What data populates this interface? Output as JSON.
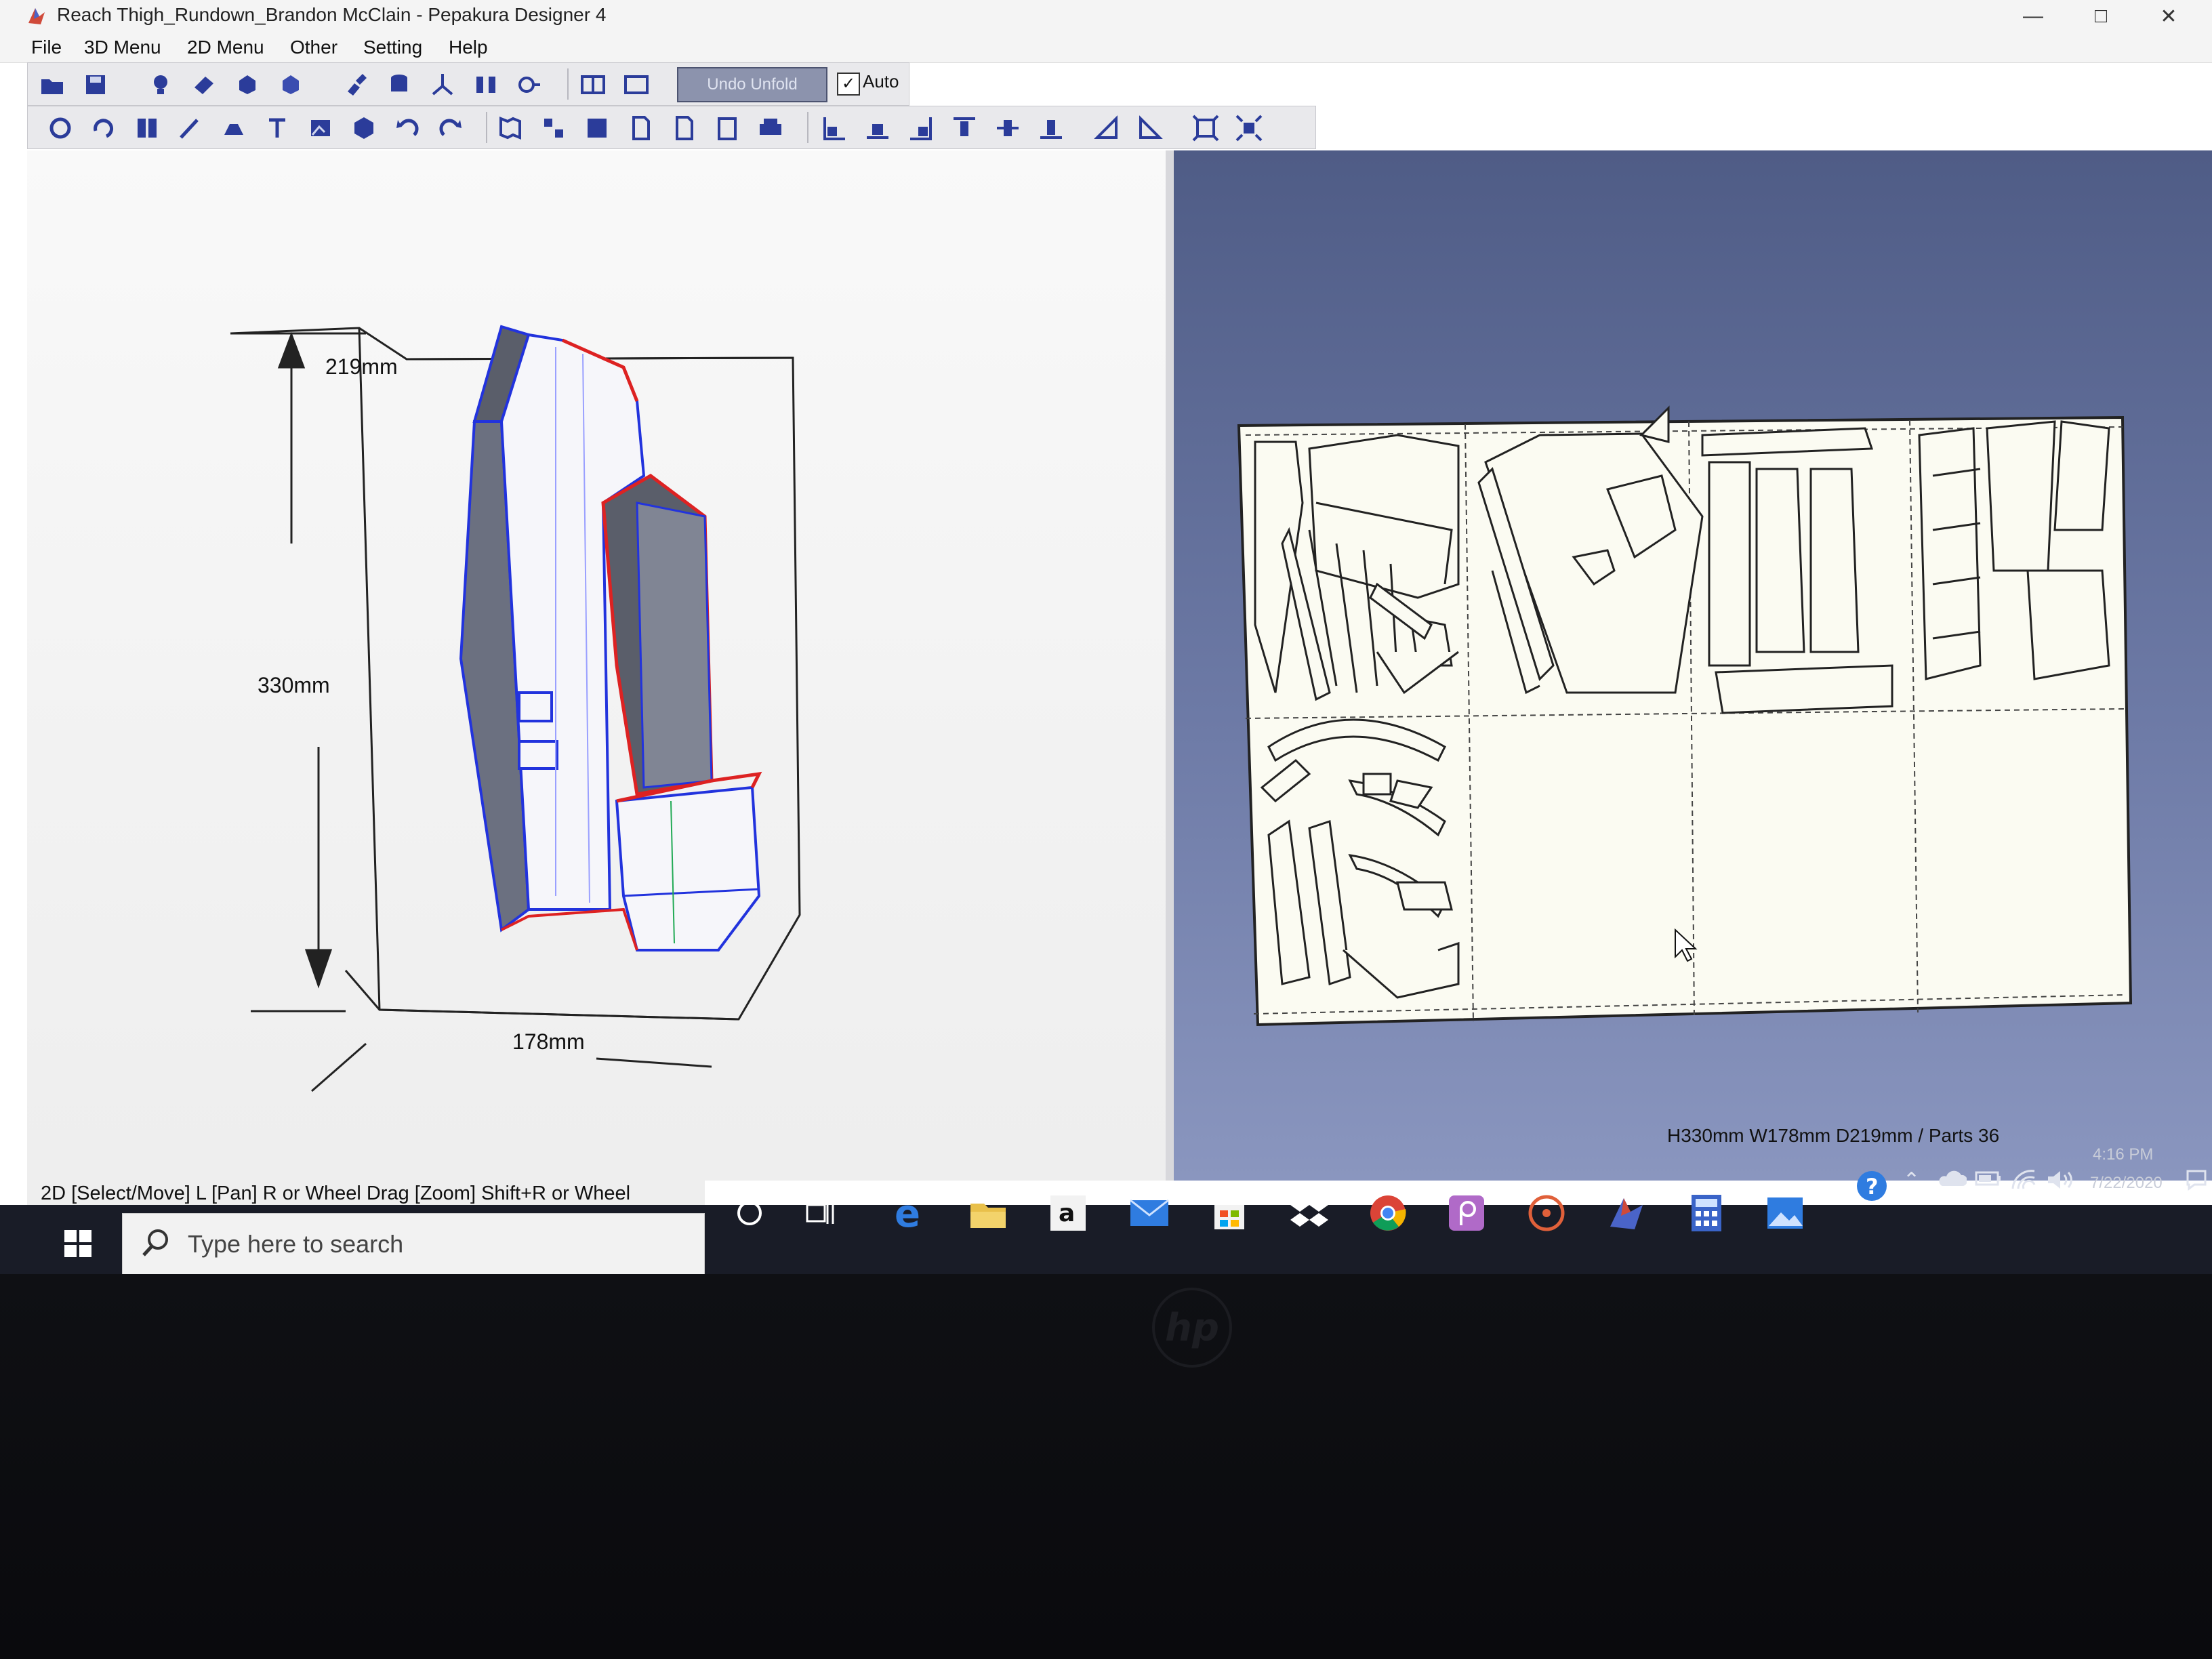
{
  "window": {
    "title": "Reach Thigh_Rundown_Brandon McClain - Pepakura Designer 4"
  },
  "menu": {
    "items": [
      "File",
      "3D Menu",
      "2D Menu",
      "Other",
      "Setting",
      "Help"
    ]
  },
  "toolbar": {
    "undo_unfold_label": "Undo Unfold",
    "auto_label": "Auto",
    "auto_checked": true
  },
  "view3d": {
    "dimension_depth": "219mm",
    "dimension_height": "330mm",
    "dimension_width": "178mm",
    "edge_colors": {
      "mountain": "#2233dd",
      "valley": "#dd2222",
      "model_fill": "#f6f6fa",
      "shade": "#555a66"
    }
  },
  "status": {
    "hint": "2D [Select/Move] L [Pan] R or Wheel Drag [Zoom] Shift+R or Wheel",
    "dimensions": "H330mm W178mm D219mm / Parts 36"
  },
  "taskbar": {
    "search_placeholder": "Type here to search",
    "pinned_icons": [
      "cortana-icon",
      "task-view-icon",
      "edge-icon",
      "file-explorer-icon",
      "amazon-icon",
      "mail-icon",
      "store-icon",
      "dropbox-icon",
      "chrome-icon",
      "picsart-icon",
      "groove-icon",
      "pepakura-icon",
      "calculator-icon",
      "photos-icon"
    ],
    "clock_time": "4:16 PM",
    "clock_date": "7/22/2020"
  },
  "colors": {
    "accent": "#2233dd",
    "view2d_bg": "#5f6c98",
    "paper": "#fbfbf2",
    "taskbar": "#191c27"
  }
}
